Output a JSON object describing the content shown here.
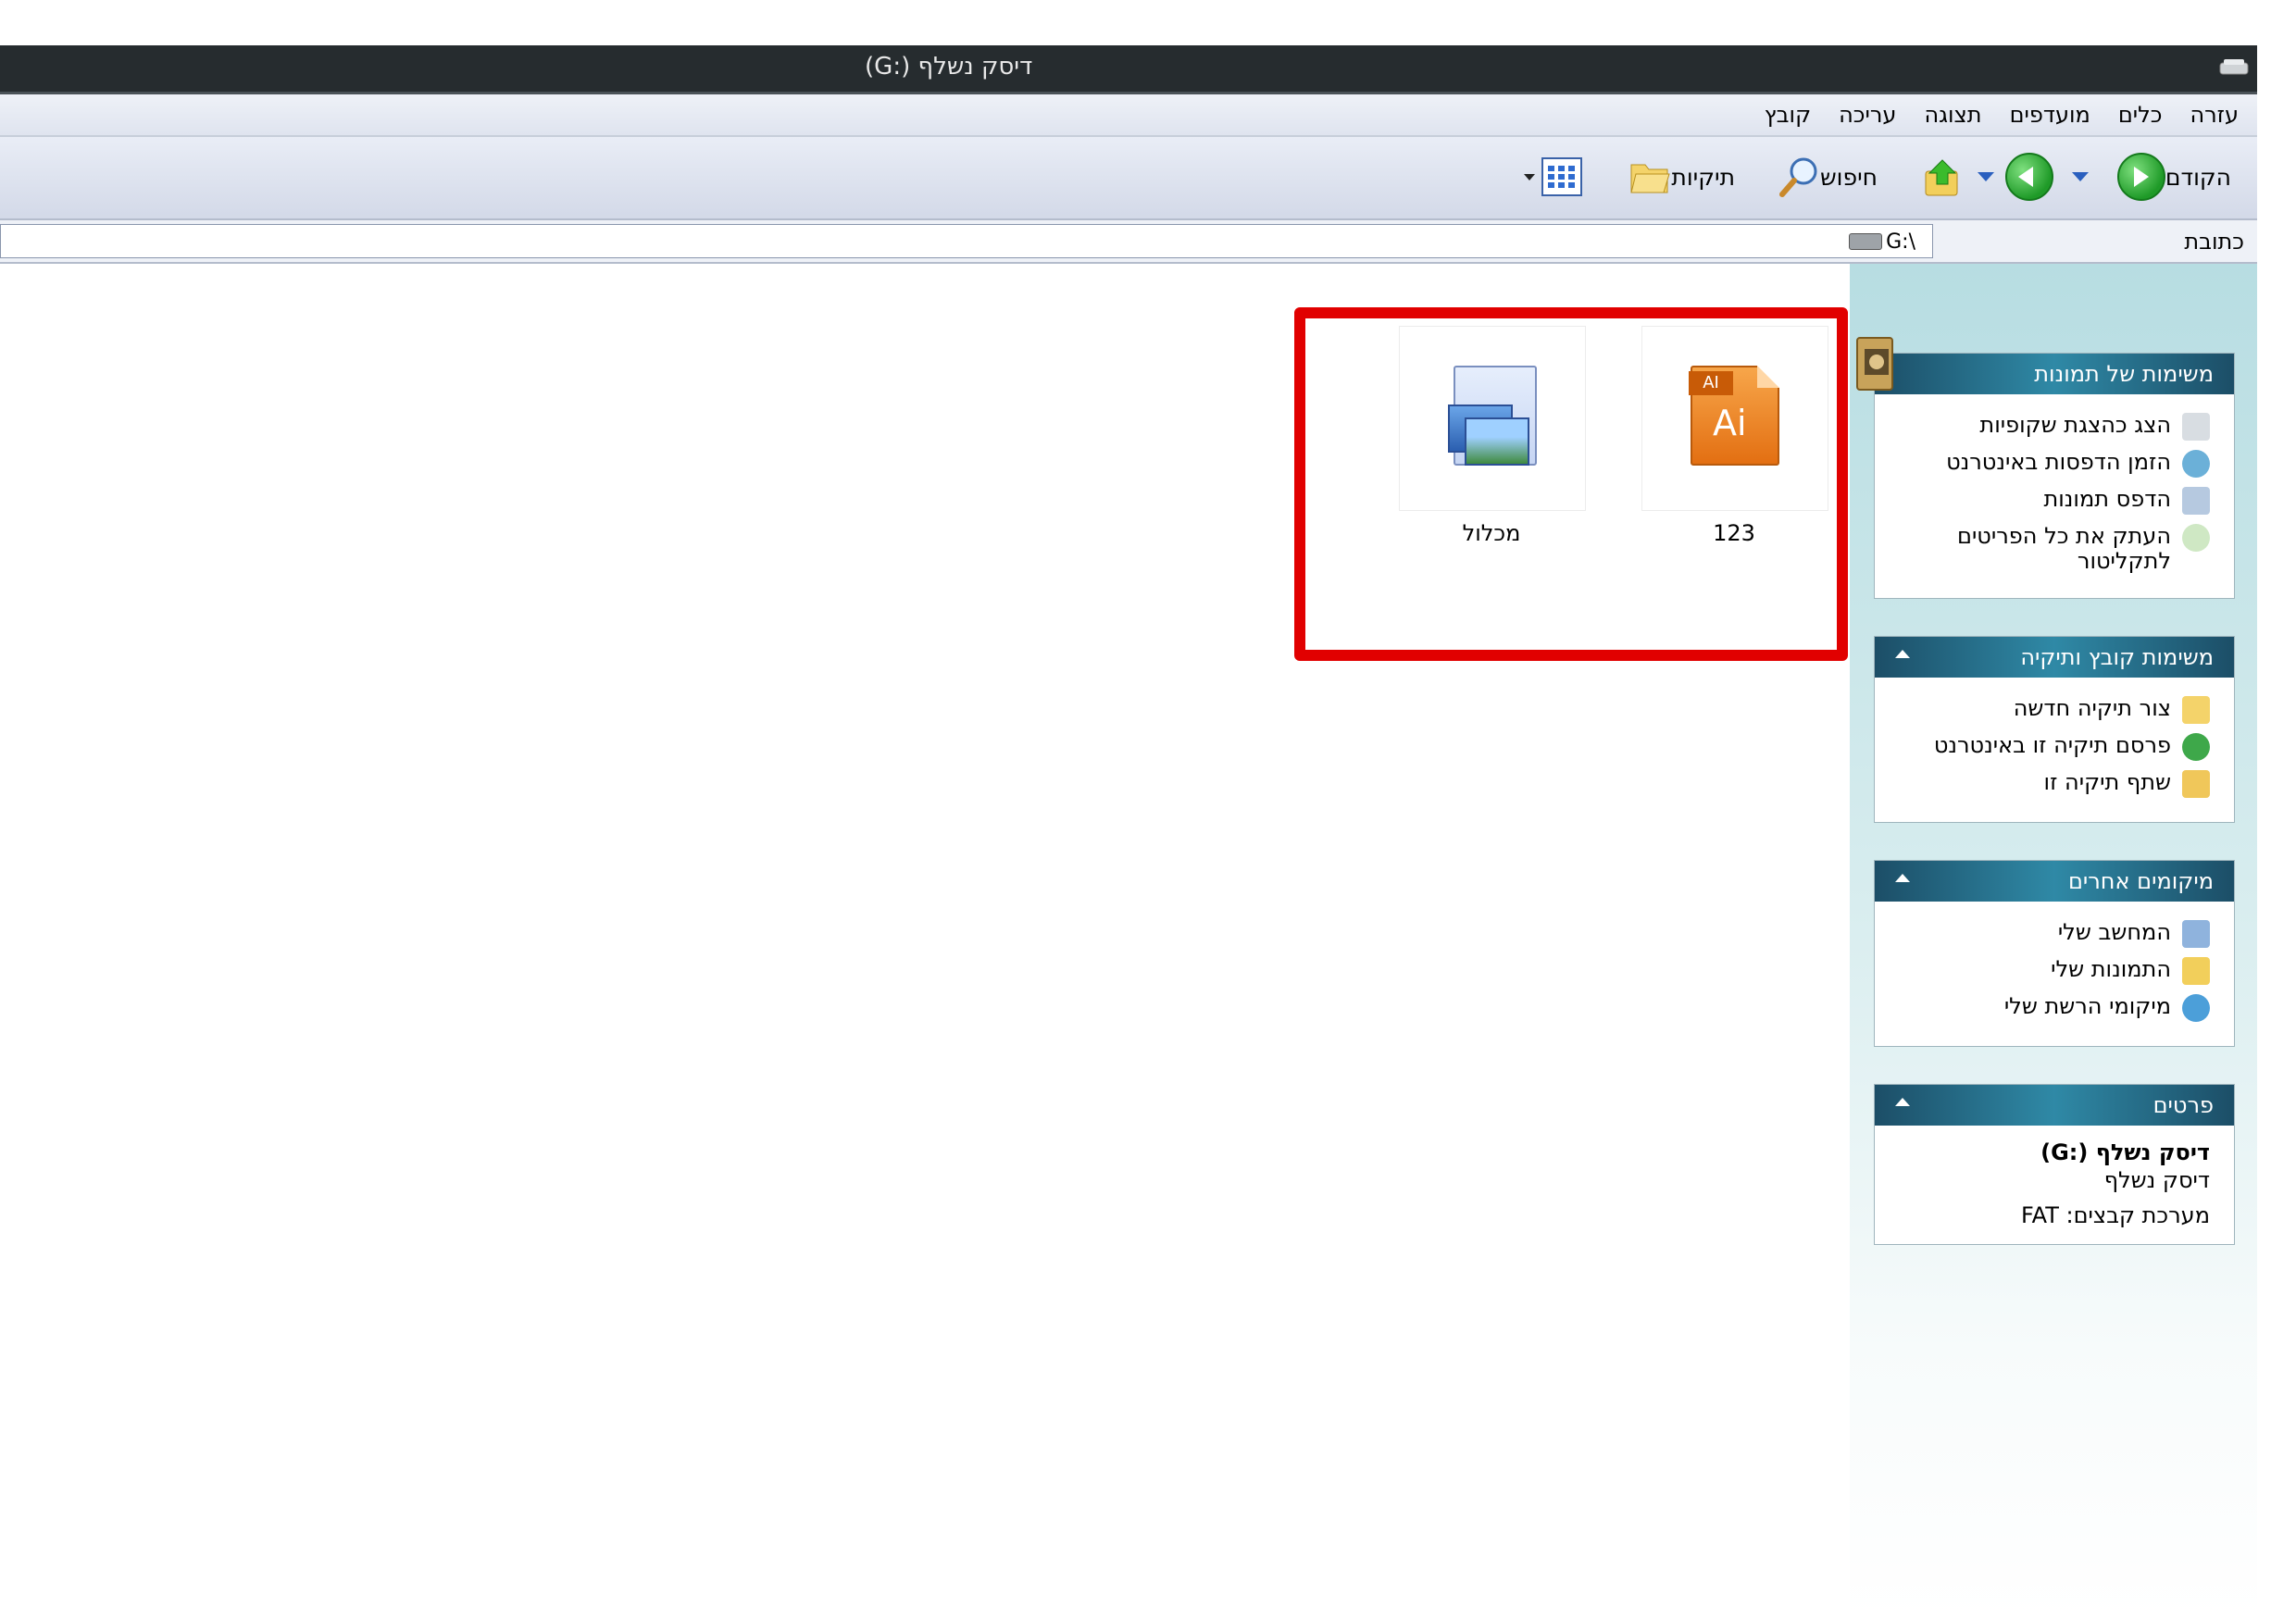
{
  "window": {
    "title": "דיסק נשלף (:G)"
  },
  "menu": {
    "items": [
      "קובץ",
      "עריכה",
      "תצוגה",
      "מועדפים",
      "כלים",
      "עזרה"
    ]
  },
  "toolbar": {
    "back_label": "הקודם",
    "search_label": "חיפוש",
    "folders_label": "תיקיות"
  },
  "address": {
    "label": "כתובת",
    "value": "G:\\"
  },
  "panels": {
    "picture_tasks": {
      "title": "משימות של תמונות",
      "items": [
        "הצג כהצגת שקופיות",
        "הזמן הדפסות באינטרנט",
        "הדפס תמונות",
        "העתק את כל הפריטים לתקליטור"
      ]
    },
    "file_tasks": {
      "title": "משימות קובץ ותיקיה",
      "items": [
        "צור תיקיה חדשה",
        "פרסם תיקיה זו באינטרנט",
        "שתף תיקיה זו"
      ]
    },
    "other_places": {
      "title": "מיקומים אחרים",
      "items": [
        "המחשב שלי",
        "התמונות שלי",
        "מיקומי הרשת שלי"
      ]
    },
    "details": {
      "title": "פרטים",
      "name": "דיסק נשלף (:G)",
      "type": "דיסק נשלף",
      "filesystem": "מערכת קבצים: FAT"
    }
  },
  "files": [
    {
      "name": "123",
      "icon": "illustrator-file-icon"
    },
    {
      "name": "מכלול",
      "icon": "image-file-icon"
    }
  ],
  "colors": {
    "highlight": "#e10000",
    "panel_header": "#1c4e67",
    "title_bar": "#262c2f"
  }
}
